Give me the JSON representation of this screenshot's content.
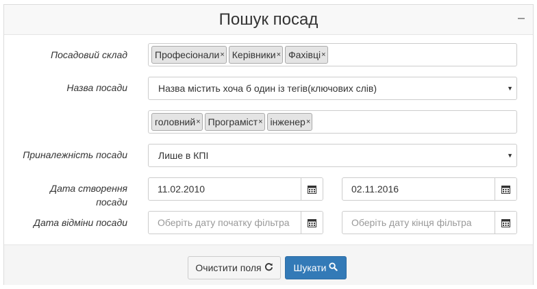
{
  "panel": {
    "title": "Пошук посад",
    "collapse_icon": "minus-icon"
  },
  "staff_composition": {
    "label": "Посадовий склад",
    "tags": [
      "Професіонали",
      "Керівники",
      "Фахівці"
    ]
  },
  "position_name": {
    "label": "Назва посади",
    "selected": "Назва містить хоча б один із тегів(ключових слів)",
    "keywords": [
      "головний",
      "Програміст",
      "інженер"
    ]
  },
  "position_affiliation": {
    "label": "Приналежність посади",
    "selected": "Лише в КПІ"
  },
  "creation_date": {
    "label": "Дата створення посади",
    "from": "11.02.2010",
    "to": "02.11.2016"
  },
  "cancellation_date": {
    "label": "Дата відміни посади",
    "from_placeholder": "Оберіть дату початку фільтра",
    "to_placeholder": "Оберіть дату кінця фільтра"
  },
  "buttons": {
    "clear_label": "Очистити поля",
    "clear_icon": "refresh-icon",
    "search_label": "Шукати",
    "search_icon": "search-icon"
  },
  "colors": {
    "primary": "#337ab7",
    "tag_bg": "#e4e4e4",
    "border": "#cccccc"
  }
}
